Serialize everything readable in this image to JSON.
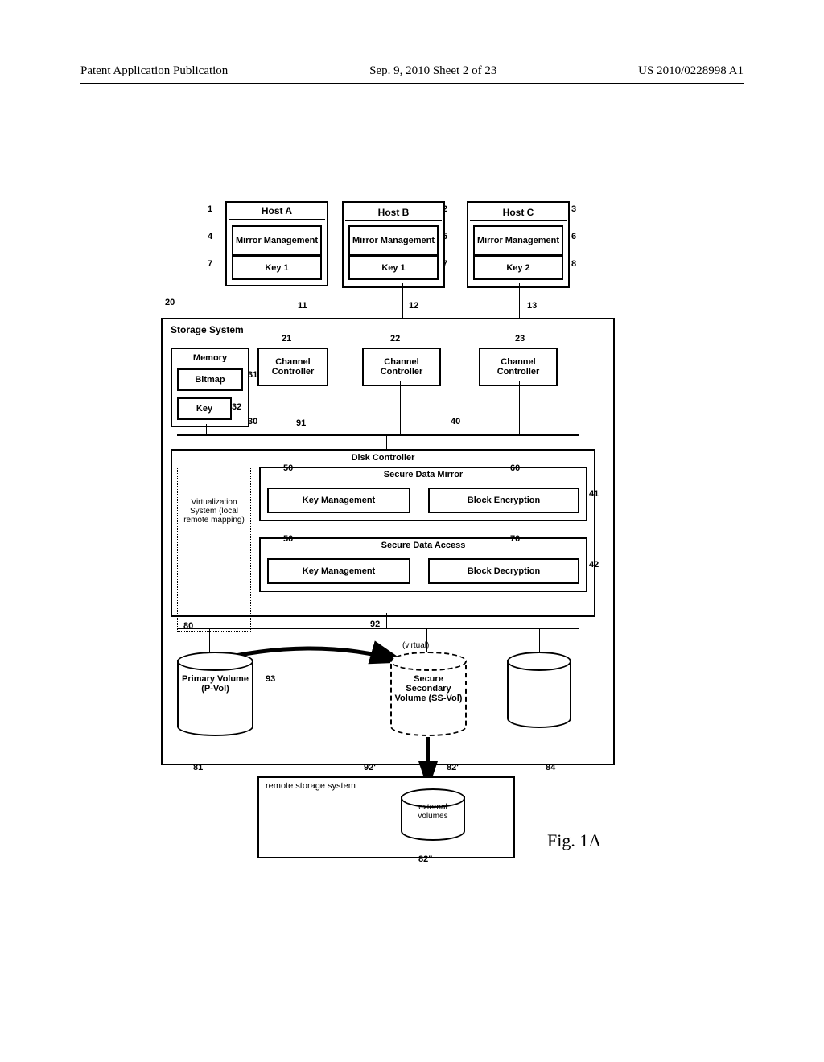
{
  "header": {
    "left": "Patent Application Publication",
    "center": "Sep. 9, 2010  Sheet 2 of 23",
    "right": "US 2010/0228998 A1"
  },
  "figure_label": "Fig. 1A",
  "hosts": {
    "a": {
      "title": "Host A",
      "sub": "Mirror Management",
      "key": "Key 1"
    },
    "b": {
      "title": "Host B",
      "sub": "Mirror Management",
      "key": "Key 1"
    },
    "c": {
      "title": "Host C",
      "sub": "Mirror Management",
      "key": "Key 2"
    }
  },
  "ref": {
    "host_a": "1",
    "host_b": "2",
    "host_c": "3",
    "mm_a": "4",
    "mm_b": "5",
    "mm_c": "6",
    "key_a": "7",
    "key_b": "7",
    "key_c": "8",
    "link_a": "11",
    "link_b": "12",
    "link_c": "13",
    "storage_system": "20",
    "cc1": "21",
    "cc2": "22",
    "cc3": "23",
    "memory": "30",
    "bitmap": "31",
    "key": "32",
    "disk_controller": "40",
    "sdm": "41",
    "sda": "42",
    "km1": "50",
    "km2": "50",
    "be": "60",
    "bd": "70",
    "virt": "80",
    "pvol": "81",
    "ssvol": "82'",
    "ext_vol": "82\"",
    "cyl3": "84",
    "bus_top": "91",
    "bus_bot": "92",
    "bus_bot2": "92'",
    "arrow": "93"
  },
  "labels": {
    "storage_system": "Storage System",
    "memory": "Memory",
    "bitmap": "Bitmap",
    "key": "Key",
    "channel_controller": "Channel Controller",
    "disk_controller": "Disk Controller",
    "secure_data_mirror": "Secure Data Mirror",
    "secure_data_access": "Secure Data Access",
    "key_management": "Key Management",
    "block_encryption": "Block Encryption",
    "block_decryption": "Block Decryption",
    "virtualization": "Virtualization System (local remote mapping)",
    "virtual": "(virtual)",
    "pvol": "Primary Volume (P-Vol)",
    "ssvol": "Secure Secondary Volume (SS-Vol)",
    "remote_storage": "remote storage system",
    "external_volumes": "external volumes"
  }
}
